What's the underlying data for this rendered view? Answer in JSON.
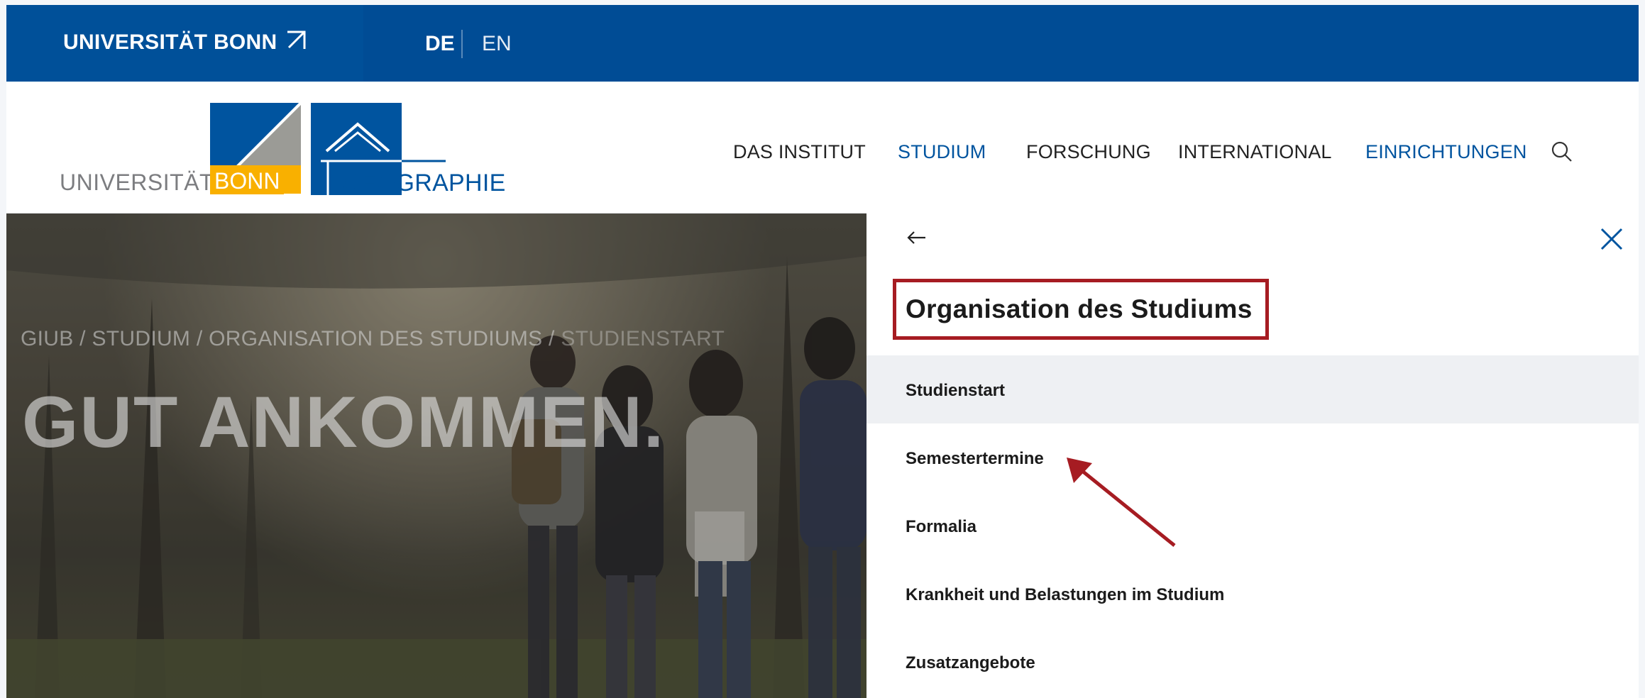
{
  "topbar": {
    "university_link": "UNIVERSITÄT BONN",
    "lang_de": "DE",
    "lang_en": "EN"
  },
  "logo": {
    "uni_text": "UNIVERSITÄT",
    "bonn_text": "BONN",
    "geo_text": "GEOGRAPHIE"
  },
  "nav": {
    "items": [
      {
        "label": "DAS INSTITUT"
      },
      {
        "label": "STUDIUM"
      },
      {
        "label": "FORSCHUNG"
      },
      {
        "label": "INTERNATIONAL"
      },
      {
        "label": "EINRICHTUNGEN"
      }
    ],
    "active": "STUDIUM"
  },
  "hero": {
    "breadcrumb": "GIUB / STUDIUM / ORGANISATION DES STUDIUMS / ",
    "breadcrumb_current": "STUDIENSTART",
    "title": "GUT ANKOMMEN."
  },
  "panel": {
    "title": "Organisation des Studiums",
    "items": [
      {
        "label": "Studienstart"
      },
      {
        "label": "Semestertermine"
      },
      {
        "label": "Formalia"
      },
      {
        "label": "Krankheit und Belastungen im Studium"
      },
      {
        "label": "Zusatzangebote"
      }
    ]
  },
  "colors": {
    "brand_blue": "#00549f",
    "topbar_blue": "#004c95",
    "bonn_yellow": "#f9b000",
    "annotation_red": "#a61c22"
  }
}
